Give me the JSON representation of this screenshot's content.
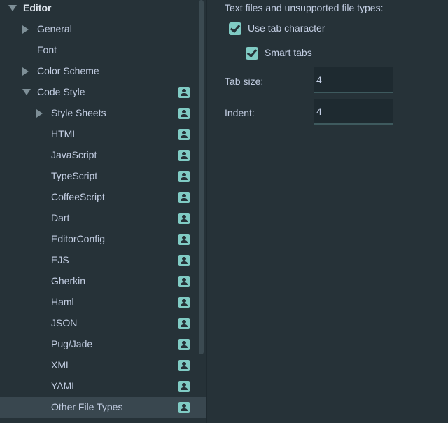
{
  "sidebar": {
    "items": [
      {
        "label": "Editor",
        "arrow": "down",
        "indent": 0,
        "bold": true,
        "scheme": false,
        "selected": false
      },
      {
        "label": "General",
        "arrow": "right",
        "indent": 1,
        "bold": false,
        "scheme": false,
        "selected": false
      },
      {
        "label": "Font",
        "arrow": "none",
        "indent": 1,
        "bold": false,
        "scheme": false,
        "selected": false
      },
      {
        "label": "Color Scheme",
        "arrow": "right",
        "indent": 1,
        "bold": false,
        "scheme": false,
        "selected": false
      },
      {
        "label": "Code Style",
        "arrow": "down",
        "indent": 1,
        "bold": false,
        "scheme": true,
        "selected": false
      },
      {
        "label": "Style Sheets",
        "arrow": "right",
        "indent": 2,
        "bold": false,
        "scheme": true,
        "selected": false
      },
      {
        "label": "HTML",
        "arrow": "none",
        "indent": 2,
        "bold": false,
        "scheme": true,
        "selected": false
      },
      {
        "label": "JavaScript",
        "arrow": "none",
        "indent": 2,
        "bold": false,
        "scheme": true,
        "selected": false
      },
      {
        "label": "TypeScript",
        "arrow": "none",
        "indent": 2,
        "bold": false,
        "scheme": true,
        "selected": false
      },
      {
        "label": "CoffeeScript",
        "arrow": "none",
        "indent": 2,
        "bold": false,
        "scheme": true,
        "selected": false
      },
      {
        "label": "Dart",
        "arrow": "none",
        "indent": 2,
        "bold": false,
        "scheme": true,
        "selected": false
      },
      {
        "label": "EditorConfig",
        "arrow": "none",
        "indent": 2,
        "bold": false,
        "scheme": true,
        "selected": false
      },
      {
        "label": "EJS",
        "arrow": "none",
        "indent": 2,
        "bold": false,
        "scheme": true,
        "selected": false
      },
      {
        "label": "Gherkin",
        "arrow": "none",
        "indent": 2,
        "bold": false,
        "scheme": true,
        "selected": false
      },
      {
        "label": "Haml",
        "arrow": "none",
        "indent": 2,
        "bold": false,
        "scheme": true,
        "selected": false
      },
      {
        "label": "JSON",
        "arrow": "none",
        "indent": 2,
        "bold": false,
        "scheme": true,
        "selected": false
      },
      {
        "label": "Pug/Jade",
        "arrow": "none",
        "indent": 2,
        "bold": false,
        "scheme": true,
        "selected": false
      },
      {
        "label": "XML",
        "arrow": "none",
        "indent": 2,
        "bold": false,
        "scheme": true,
        "selected": false
      },
      {
        "label": "YAML",
        "arrow": "none",
        "indent": 2,
        "bold": false,
        "scheme": true,
        "selected": false
      },
      {
        "label": "Other File Types",
        "arrow": "none",
        "indent": 2,
        "bold": false,
        "scheme": true,
        "selected": true
      }
    ],
    "scheme_icon": "user-scheme-icon"
  },
  "settings": {
    "heading": "Text files and unsupported file types:",
    "use_tab_character": {
      "label": "Use tab character",
      "checked": true
    },
    "smart_tabs": {
      "label": "Smart tabs",
      "checked": true
    },
    "tab_size": {
      "label": "Tab size:",
      "value": "4"
    },
    "indent": {
      "label": "Indent:",
      "value": "4"
    }
  },
  "colors": {
    "background": "#263238",
    "accent": "#80cbc4",
    "selection": "#39474f",
    "text": "#c3cee3"
  }
}
